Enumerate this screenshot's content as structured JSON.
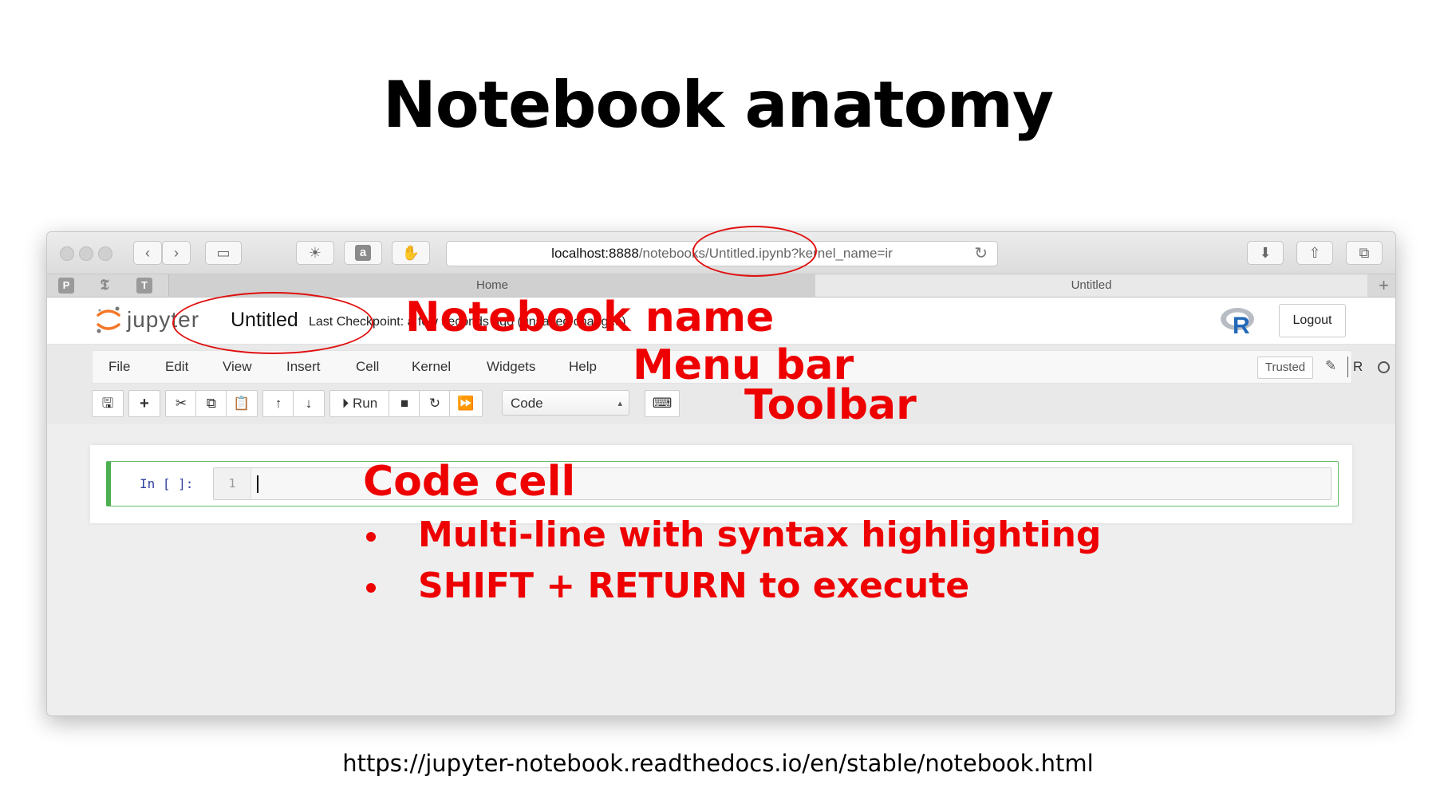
{
  "slide": {
    "title": "Notebook anatomy",
    "source_url": "https://jupyter-notebook.readthedocs.io/en/stable/notebook.html"
  },
  "browser": {
    "url_host": "localhost:8888",
    "url_path": "/notebooks/Untitled.ipynb?kernel_name=ir",
    "tabs": [
      {
        "label": "Home"
      },
      {
        "label": "Untitled"
      }
    ],
    "favorites": [
      "P",
      "T"
    ]
  },
  "jupyter": {
    "logo_text": "jupyter",
    "notebook_name": "Untitled",
    "checkpoint_text": "Last Checkpoint: a few seconds ago (unsaved changes)",
    "logout_label": "Logout",
    "menu": [
      "File",
      "Edit",
      "View",
      "Insert",
      "Cell",
      "Kernel",
      "Widgets",
      "Help"
    ],
    "trusted_label": "Trusted",
    "kernel_name": "R",
    "toolbar": {
      "run_label": "Run",
      "cell_type": "Code"
    },
    "cell": {
      "prompt": "In [ ]:",
      "line_number": "1"
    }
  },
  "annotations": {
    "notebook_name": "Notebook name",
    "menu_bar": "Menu bar",
    "toolbar": "Toolbar",
    "code_cell": "Code cell",
    "bullets": [
      "Multi-line with syntax highlighting",
      "SHIFT + RETURN to execute"
    ]
  },
  "colors": {
    "annotation": "#ee0000",
    "cell_border": "#4caf50",
    "prompt": "#303f9f"
  }
}
